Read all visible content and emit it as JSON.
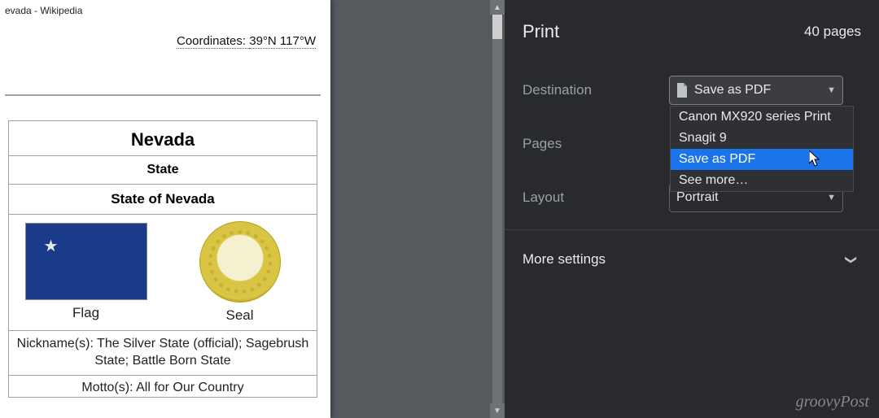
{
  "preview": {
    "header_tab": "evada - Wikipedia",
    "coordinates_label": "Coordinates:",
    "coordinates_value": "39°N 117°W",
    "infobox": {
      "title": "Nevada",
      "subtitle": "State",
      "subtitle2": "State of Nevada",
      "flag_label": "Flag",
      "seal_label": "Seal",
      "nicknames": "Nickname(s): The Silver State (official); Sagebrush State; Battle Born State",
      "motto": "Motto(s): All for Our Country"
    }
  },
  "panel": {
    "title": "Print",
    "page_count": "40 pages",
    "destination": {
      "label": "Destination",
      "selected": "Save as PDF",
      "options": [
        "Canon MX920 series Print",
        "Snagit 9",
        "Save as PDF",
        "See more…"
      ],
      "selected_index": 2
    },
    "pages": {
      "label": "Pages"
    },
    "layout": {
      "label": "Layout",
      "value": "Portrait"
    },
    "more": "More settings"
  },
  "watermark": "groovyPost"
}
